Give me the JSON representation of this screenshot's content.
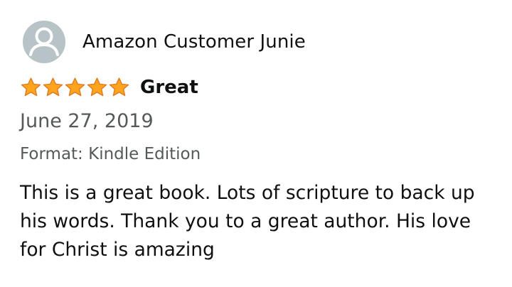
{
  "reviewer": {
    "name": "Amazon Customer Junie",
    "avatar_icon": "default-user-avatar-icon"
  },
  "rating": {
    "stars": 5,
    "max_stars": 5,
    "star_color": "#ffa41c"
  },
  "review": {
    "title": "Great",
    "date": "June 27, 2019",
    "format": "Format: Kindle Edition",
    "body": "This is a great book. Lots of scripture to back up his words. Thank you to a great author. His love for Christ is amazing"
  }
}
